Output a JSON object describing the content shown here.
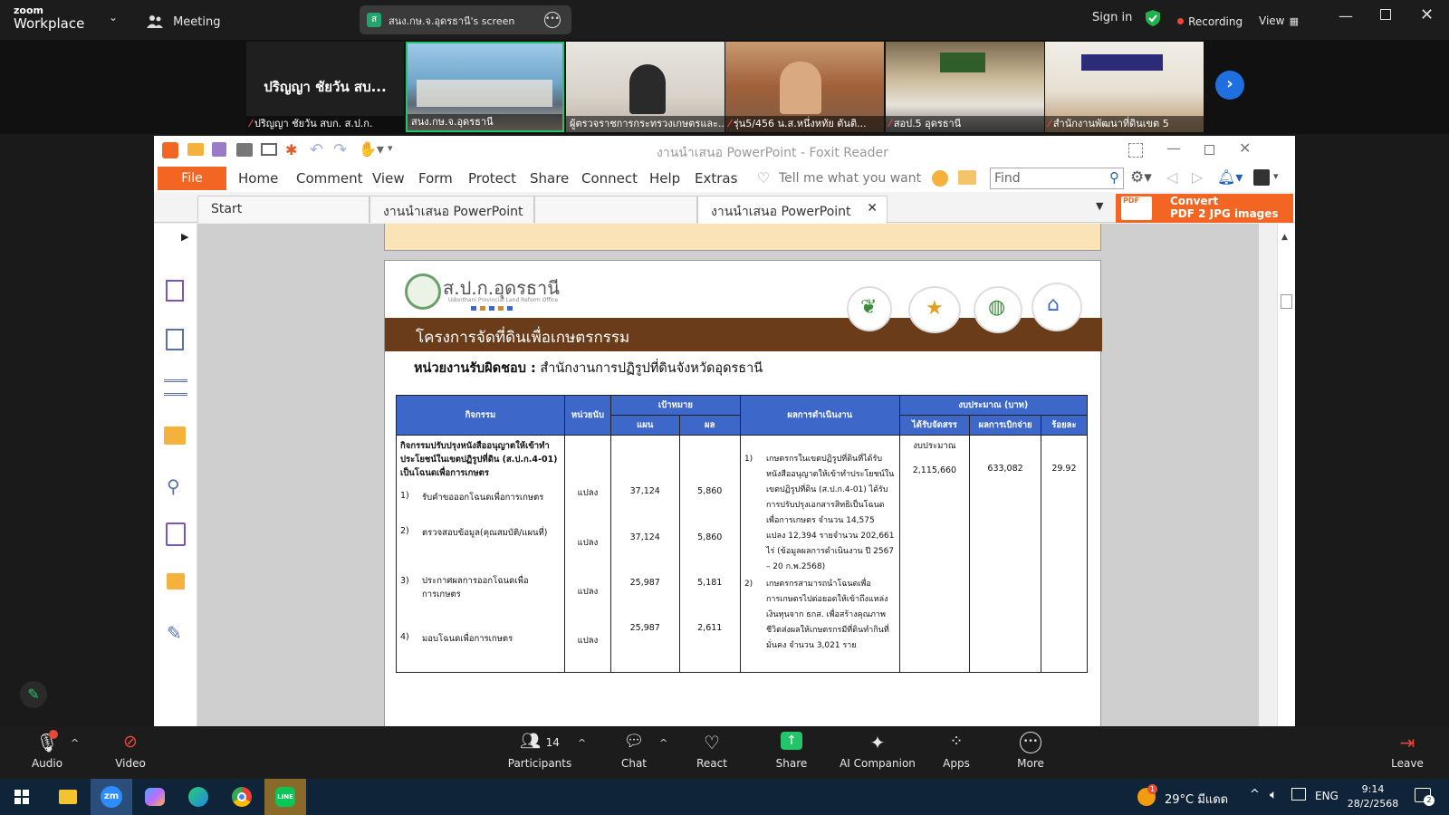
{
  "zoom": {
    "brand_top": "zoom",
    "brand_bottom": "Workplace",
    "meeting_label": "Meeting",
    "share_badge": "ส",
    "share_title": "สนง.กษ.จ.อุดรธานี's screen",
    "sign_in": "Sign in",
    "recording": "Recording",
    "view": "View"
  },
  "thumbnails": [
    {
      "display_name": "ปริญญา ชัยวัน สบ...",
      "label": "ปริญญา ชัยวัน สบก. ส.ป.ก.",
      "muted": true
    },
    {
      "label": "สนง.กษ.จ.อุดรธานี",
      "muted": false,
      "active": true
    },
    {
      "label": "ผู้ตรวจราชการกระทรวงเกษตรและ...",
      "muted": false
    },
    {
      "label": "รุ่น5/456 น.ส.หนึ่งหทัย ตันติ...",
      "muted": true
    },
    {
      "label": "สอป.5 อุดรธานี",
      "muted": true
    },
    {
      "label": "สำนักงานพัฒนาที่ดินเขต 5",
      "muted": true
    }
  ],
  "foxit": {
    "title": "งานนำเสนอ PowerPoint - Foxit Reader",
    "menu": [
      "File",
      "Home",
      "Comment",
      "View",
      "Form",
      "Protect",
      "Share",
      "Connect",
      "Help",
      "Extras"
    ],
    "tell_me": "Tell me what you want to",
    "find_placeholder": "Find",
    "tabs": [
      "Start",
      "งานนำเสนอ PowerPoint",
      "",
      "งานนำเสนอ PowerPoint"
    ],
    "convert_line1": "Convert",
    "convert_line2": "PDF 2 JPG images",
    "convert_badge": "PDF"
  },
  "slide": {
    "org_name": "ส.ป.ก.อุดรธานี",
    "org_sub": "Udonthani Provincial Land Reform Office",
    "banner": "โครงการจัดที่ดินเพื่อเกษตรกรรม",
    "responsible_label": "หน่วยงานรับผิดชอบ :",
    "responsible_value": "สำนักงานการปฏิรูปที่ดินจังหวัดอุดรธานี",
    "headers": {
      "activity": "กิจกรรม",
      "unit": "หน่วยนับ",
      "target": "เป้าหมาย",
      "plan": "แผน",
      "result": "ผล",
      "outcome": "ผลการดำเนินงาน",
      "budget": "งบประมาณ (บาท)",
      "allocated": "ได้รับจัดสรร",
      "disbursed": "ผลการเบิกจ่าย",
      "percent": "ร้อยละ"
    },
    "activity_title": "กิจกรรมปรับปรุงหนังสืออนุญาตให้เข้าทำประโยชน์ในเขตปฏิรูปที่ดิน (ส.ป.ก.4-01) เป็นโฉนดเพื่อการเกษตร",
    "rows": [
      {
        "num": "1)",
        "name": "รับคำขอออกโฉนดเพื่อการเกษตร",
        "unit": "แปลง",
        "plan": "37,124",
        "result": "5,860"
      },
      {
        "num": "2)",
        "name": "ตรวจสอบข้อมูล(คุณสมบัติ/แผนที่)",
        "unit": "แปลง",
        "plan": "37,124",
        "result": "5,860"
      },
      {
        "num": "3)",
        "name": "ประกาศผลการออกโฉนดเพื่อการเกษตร",
        "unit": "แปลง",
        "plan": "25,987",
        "result": "5,181"
      },
      {
        "num": "4)",
        "name": "มอบโฉนดเพื่อการเกษตร",
        "unit": "แปลง",
        "plan": "25,987",
        "result": "2,611"
      }
    ],
    "outcome_1_num": "1)",
    "outcome_1": "เกษตรกรในเขตปฏิรูปที่ดินที่ได้รับหนังสืออนุญาตให้เข้าทำประโยชน์ในเขตปฏิรูปที่ดิน (ส.ป.ก.4-01) ได้รับการปรับปรุงเอกสารสิทธิเป็นโฉนดเพื่อการเกษตร จำนวน 14,575 แปลง 12,394 รายจำนวน 202,661 ไร่ (ข้อมูลผลการดำเนินงาน ปี 2567 – 20 ก.พ.2568)",
    "outcome_2_num": "2)",
    "outcome_2": "เกษตรกรสามารถนำโฉนดเพื่อการเกษตรไปต่อยอดให้เข้าถึงแหล่งเงินทุนจาก ธกส. เพื่อสร้างคุณภาพชีวิตส่งผลให้เกษตรกรมีที่ดินทำกินที่มั่นคง จำนวน 3,021 ราย",
    "budget_label": "งบประมาณ",
    "allocated": "2,115,660",
    "disbursed": "633,082",
    "percent": "29.92"
  },
  "toolbar": {
    "audio": "Audio",
    "video": "Video",
    "participants": "Participants",
    "participants_count": "14",
    "chat": "Chat",
    "react": "React",
    "share": "Share",
    "ai": "AI Companion",
    "apps": "Apps",
    "more": "More",
    "leave": "Leave"
  },
  "taskbar": {
    "temperature": "29°C",
    "weather_text": "มีแดด",
    "weather_badge": "1",
    "lang": "ENG",
    "time": "9:14",
    "date": "28/2/2568",
    "notif_count": "2"
  }
}
